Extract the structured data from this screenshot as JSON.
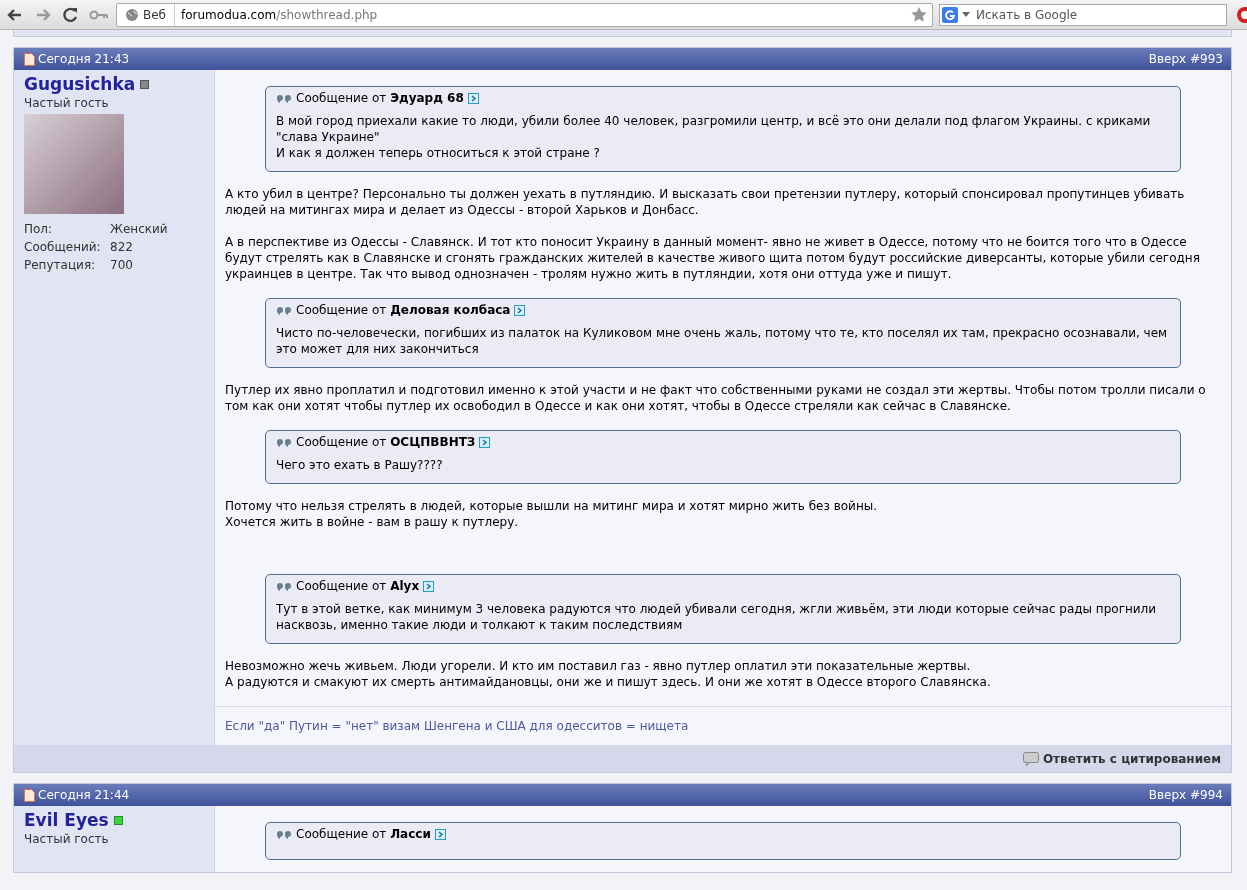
{
  "browser": {
    "site_label": "Веб",
    "url_host": "forumodua.com",
    "url_path": "/showthread.php",
    "search_placeholder": "Искать в Google"
  },
  "posts": [
    {
      "date": "Сегодня 21:43",
      "link": "Вверх",
      "number": "#993",
      "user": {
        "name": "Gugusichka",
        "online": false,
        "rank": "Частый гость",
        "has_avatar": true,
        "stats": [
          {
            "label": "Пол:",
            "value": "Женский"
          },
          {
            "label": "Сообщений:",
            "value": "822"
          },
          {
            "label": "Репутация:",
            "value": "700"
          }
        ]
      },
      "body": [
        {
          "kind": "quote",
          "prefix": "Сообщение от",
          "author": "Эдуард 68",
          "lines": [
            "В мой город приехали какие то люди, убили более 40 человек, разгромили центр, и всё это они делали под флагом Украины. с криками \"слава Украине\"",
            "И как я должен теперь относиться к этой стране ?"
          ]
        },
        {
          "kind": "text",
          "lines": [
            "А кто убил в центре? Персонально ты должен уехать в путляндию. И высказать свои претензии путлеру, который спонсировал пропутинцев убивать людей на митингах мира и делает из Одессы - второй Харьков и Донбасс."
          ]
        },
        {
          "kind": "text",
          "lines": [
            "А в перспективе из Одессы - Славянск. И тот кто поносит Украину в данный момент- явно не живет в Одессе, потому что не боится того что в Одессе будут стрелять как в Славянске и сгонять гражданских жителей в качестве живого щита потом будут российские диверсанты, которые убили сегодня украинцев в центре. Так что вывод однозначен - тролям нужно жить в путляндии, хотя они оттуда уже и пишут."
          ]
        },
        {
          "kind": "quote",
          "prefix": "Сообщение от",
          "author": "Деловая колбаса",
          "lines": [
            "Чисто по-человечески, погибших из палаток на Куликовом мне очень жаль, потому что те, кто поселял их там, прекрасно осознавали, чем это может для них закончиться"
          ]
        },
        {
          "kind": "text",
          "lines": [
            "Путлер их явно проплатил и подготовил именно к этой участи и не факт что собственными руками не создал эти жертвы. Чтобы потом тролли писали о том как они хотят чтобы путлер их освободил в Одессе и как они хотят, чтобы в Одессе стреляли как сейчас в Славянске."
          ]
        },
        {
          "kind": "quote",
          "prefix": "Сообщение от",
          "author": "ОСЦПВВНТЗ",
          "lines": [
            "Чего это ехать в Рашу????"
          ]
        },
        {
          "kind": "text",
          "lines": [
            "Потому что нельзя стрелять в людей, которые вышли на митинг мира и хотят мирно жить без войны.",
            "Хочется жить в войне - вам в рашу к путлеру."
          ]
        },
        {
          "kind": "gap"
        },
        {
          "kind": "quote",
          "prefix": "Сообщение от",
          "author": "Alyx",
          "lines": [
            "Тут в этой ветке, как минимум 3 человека радуются что людей убивали сегодня, жгли живьём, эти люди которые сейчас рады прогнили насквозь, именно такие люди и толкают к таким последствиям"
          ]
        },
        {
          "kind": "text",
          "lines": [
            "Невозможно жечь живьем. Люди угорели. И кто им поставил газ - явно путлер оплатил эти показательные жертвы.",
            "А радуются и смакуют их смерть антимайдановцы, они же и пишут здесь. И они же хотят в Одессе второго Славянска."
          ]
        }
      ],
      "signature": "Если \"да\" Путин = \"нет\" визам Шенгена и США для одесситов = нищета",
      "reply": "Ответить с цитированием"
    },
    {
      "date": "Сегодня 21:44",
      "link": "Вверх",
      "number": "#994",
      "user": {
        "name": "Evil Eyes",
        "online": true,
        "rank": "Частый гость"
      },
      "body": [
        {
          "kind": "quote",
          "prefix": "Сообщение от",
          "author": "Ласси"
        }
      ]
    }
  ]
}
